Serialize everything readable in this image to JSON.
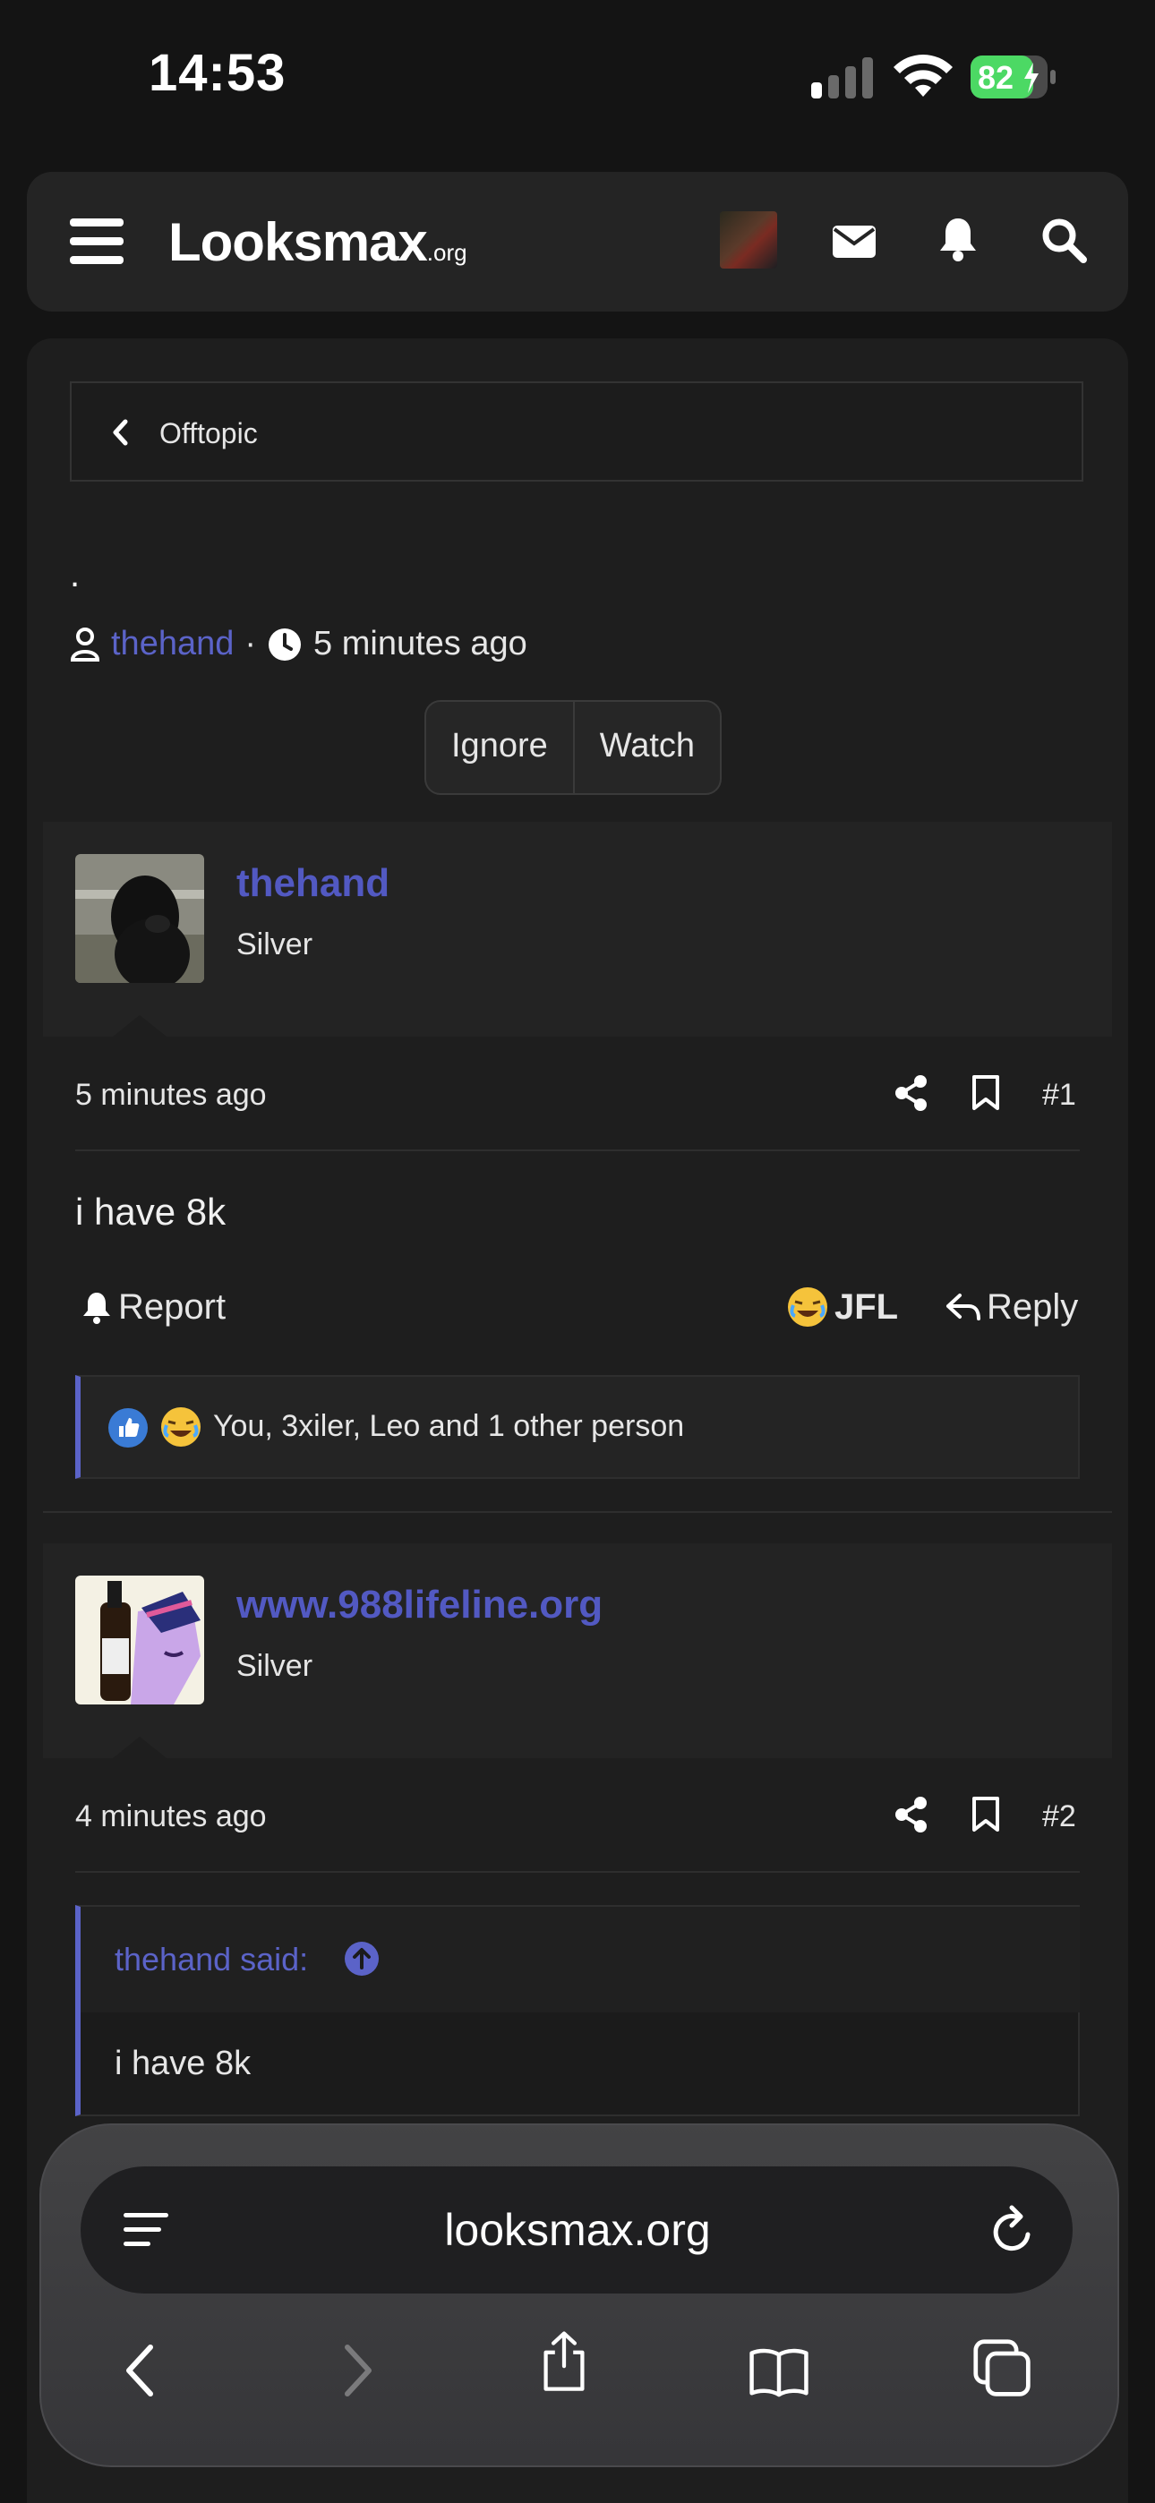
{
  "status_bar": {
    "time": "14:53",
    "battery": "82"
  },
  "header": {
    "logo_main": "Looksmax",
    "logo_suffix": ".org"
  },
  "breadcrumb": {
    "label": "Offtopic"
  },
  "thread": {
    "title": ".",
    "author": "thehand",
    "separator": "·",
    "time": "5 minutes ago",
    "ignore_label": "Ignore",
    "watch_label": "Watch"
  },
  "posts": [
    {
      "username": "thehand",
      "rank": "Silver",
      "time": "5 minutes ago",
      "number": "#1",
      "body": "i have 8k",
      "report_label": "Report",
      "jfl_label": "JFL",
      "reply_label": "Reply",
      "reactions_text": "You, 3xiler, Leo and 1 other person"
    },
    {
      "username": "www.988lifeline.org",
      "rank": "Silver",
      "time": "4 minutes ago",
      "number": "#2",
      "quote_author": "thehand said:",
      "quote_body": "i have 8k"
    }
  ],
  "browser": {
    "url": "looksmax.org"
  },
  "icons": [
    "menu-icon",
    "mail-icon",
    "bell-icon",
    "search-icon",
    "user-icon",
    "clock-icon",
    "share-icon",
    "bookmark-icon",
    "reply-icon",
    "like-icon",
    "laugh-emoji-icon",
    "back-icon",
    "forward-icon",
    "share-sheet-icon",
    "bookmarks-book-icon",
    "tabs-icon",
    "reload-icon",
    "reader-icon"
  ],
  "colors": {
    "accent": "#5b63c8",
    "background": "#141414",
    "panel": "#1e1e1e",
    "battery": "#4cd964"
  }
}
